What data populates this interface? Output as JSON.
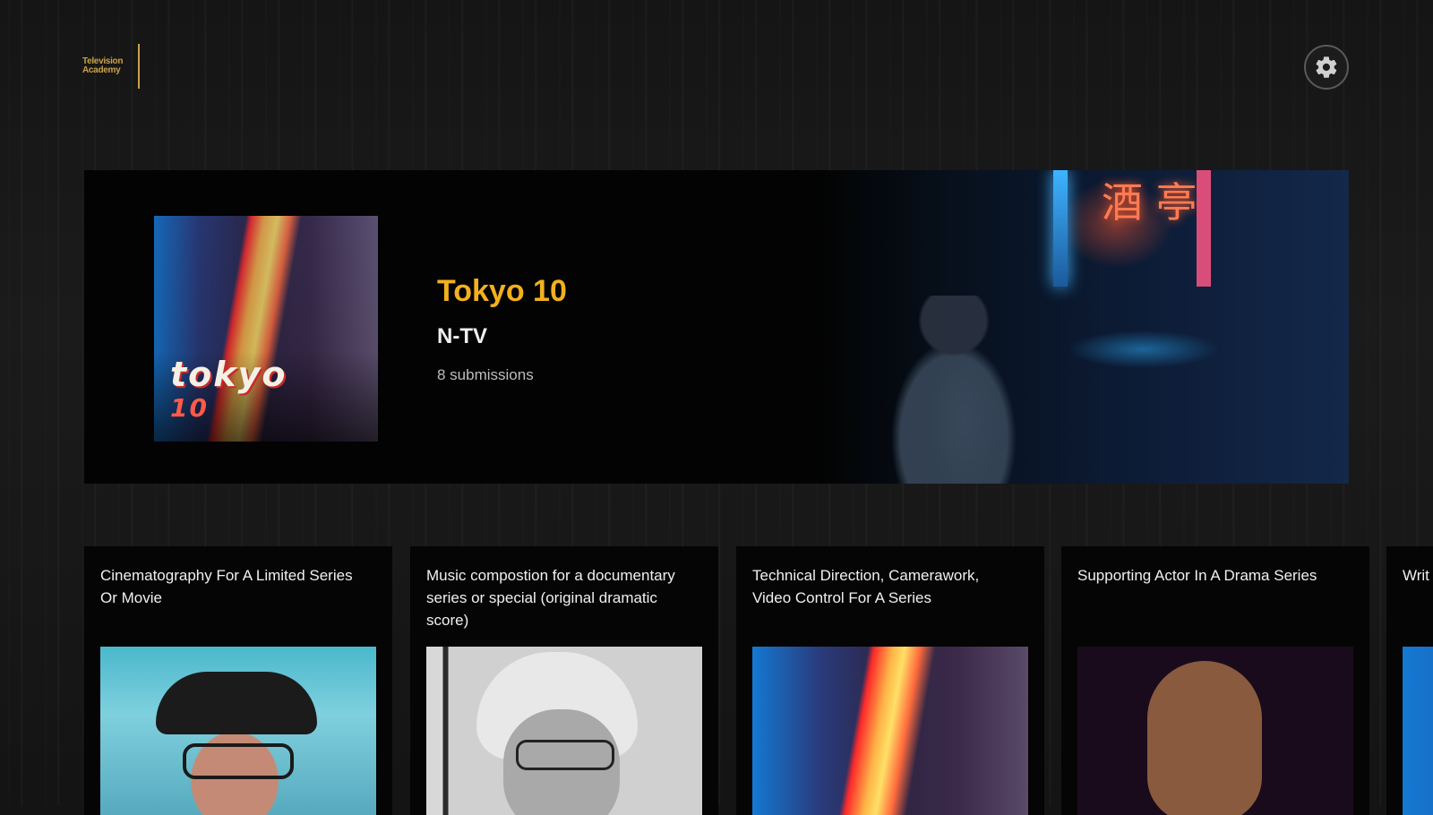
{
  "header": {
    "logo_text": "Television Academy",
    "settings_icon": "gear-icon"
  },
  "featured": {
    "poster_title": "tokyo",
    "poster_number": "10",
    "title": "Tokyo 10",
    "channel": "N-TV",
    "submissions": "8 submissions",
    "neon_sign": "酒 亭",
    "accent_color": "#f2b01e"
  },
  "categories": [
    {
      "title": "Cinematography For A Limited Series Or Movie",
      "image": "man-with-cap-and-glasses"
    },
    {
      "title": "Music compostion for a documentary series or special (original dramatic score)",
      "image": "woman-with-glasses-bw"
    },
    {
      "title": "Technical Direction, Camerawork, Video Control For A Series",
      "image": "neon-street"
    },
    {
      "title": "Supporting Actor In A Drama Series",
      "image": "bald-man-portrait"
    },
    {
      "title": "Writ",
      "image": "neon-street"
    }
  ]
}
